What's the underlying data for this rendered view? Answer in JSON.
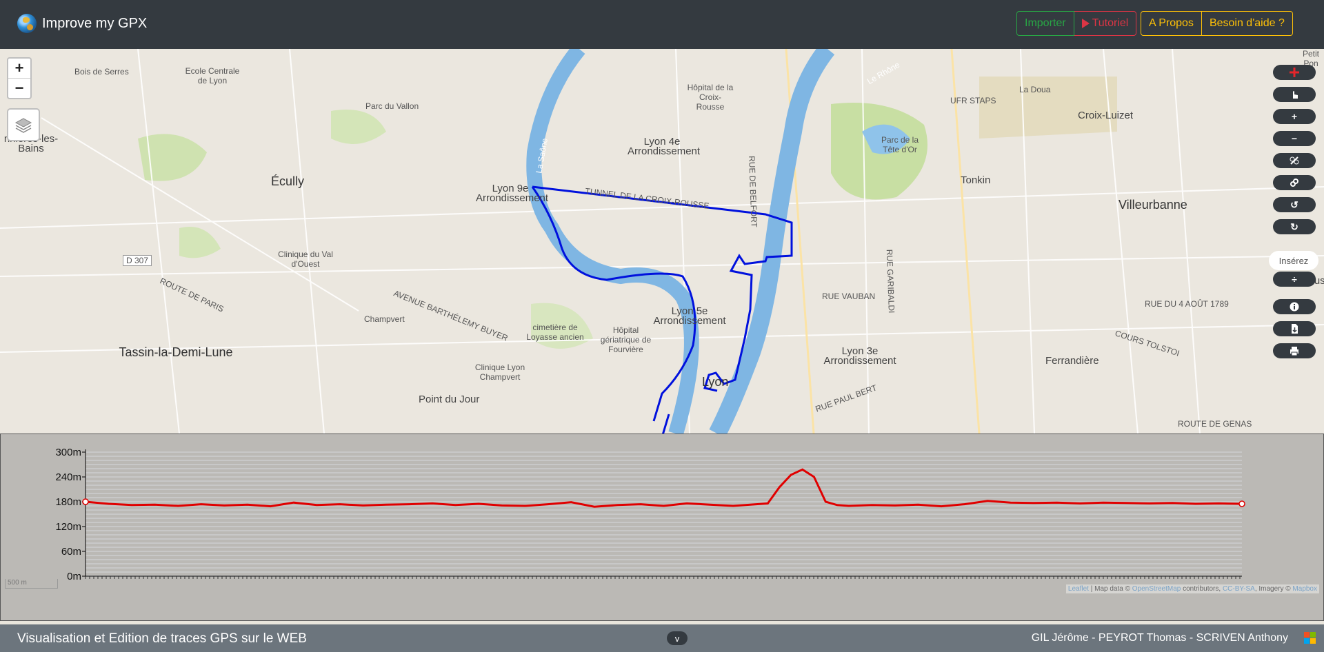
{
  "header": {
    "title": "Improve my GPX",
    "buttons": {
      "import": "Importer",
      "tutorial": "Tutoriel",
      "about": "A Propos",
      "help": "Besoin d'aide ?"
    }
  },
  "map": {
    "labels": [
      {
        "id": "bois",
        "text": "Bois de Serres"
      },
      {
        "id": "ecole",
        "text": "Ecole Centrale de Lyon"
      },
      {
        "id": "parc-vallon",
        "text": "Parc du Vallon"
      },
      {
        "id": "hopital-croix",
        "text": "Hôpital de la Croix-Rousse"
      },
      {
        "id": "lyon4",
        "text": "Lyon 4e Arrondissement"
      },
      {
        "id": "parc-tete",
        "text": "Parc de la Tête d'Or"
      },
      {
        "id": "la-doua",
        "text": "La Doua"
      },
      {
        "id": "ufr",
        "text": "UFR STAPS"
      },
      {
        "id": "croix-luizet",
        "text": "Croix-Luizet"
      },
      {
        "id": "tonkin",
        "text": "Tonkin"
      },
      {
        "id": "villeurbanne",
        "text": "Villeurbanne"
      },
      {
        "id": "ecully",
        "text": "Écully"
      },
      {
        "id": "bonnieres",
        "text": "nnières-les-Bains"
      },
      {
        "id": "lyon9",
        "text": "Lyon 9e Arrondissement"
      },
      {
        "id": "tunnel",
        "text": "TUNNEL DE LA CROIX-ROUSSE"
      },
      {
        "id": "d307",
        "text": "D 307"
      },
      {
        "id": "clinique-val",
        "text": "Clinique du Val d'Ouest"
      },
      {
        "id": "route-paris",
        "text": "ROUTE DE PARIS"
      },
      {
        "id": "champvert",
        "text": "Champvert"
      },
      {
        "id": "avenue-barthelemy",
        "text": "AVENUE BARTHÉLEMY BUYER"
      },
      {
        "id": "cimetiere",
        "text": "cimetière de Loyasse ancien"
      },
      {
        "id": "hopital-fourviere",
        "text": "Hôpital gériatrique de Fourvière"
      },
      {
        "id": "lyon5",
        "text": "Lyon 5e Arrondissement"
      },
      {
        "id": "rue-vauban",
        "text": "RUE VAUBAN"
      },
      {
        "id": "rue-4aout",
        "text": "RUE DU 4 AOÛT 1789"
      },
      {
        "id": "cours-tolstoi",
        "text": "COURS TOLSTOI"
      },
      {
        "id": "tassin",
        "text": "Tassin-la-Demi-Lune"
      },
      {
        "id": "clinique-lyon",
        "text": "Clinique Lyon Champvert"
      },
      {
        "id": "lyon3",
        "text": "Lyon 3e Arrondissement"
      },
      {
        "id": "lyon",
        "text": "Lyon"
      },
      {
        "id": "ferrandiere",
        "text": "Ferrandière"
      },
      {
        "id": "point-jour",
        "text": "Point du Jour"
      },
      {
        "id": "rue-paul-bert",
        "text": "RUE PAUL BERT"
      },
      {
        "id": "route-genas",
        "text": "ROUTE DE GENAS"
      },
      {
        "id": "petit-pont",
        "text": "Petit Pon"
      },
      {
        "id": "la-saone",
        "text": "La Saône"
      },
      {
        "id": "le-rhone",
        "text": "Le Rhône"
      },
      {
        "id": "rue-garibaldi",
        "text": "RUE GARIBALDI"
      },
      {
        "id": "rue-belfort",
        "text": "RUE DE BELFORT"
      },
      {
        "id": "cusset",
        "text": "Cusse"
      }
    ],
    "controls": {
      "zoom_in": "+",
      "zoom_out": "−",
      "insert_label": "Insérez"
    }
  },
  "elevation": {
    "y_ticks": [
      "300m",
      "240m",
      "180m",
      "120m",
      "60m",
      "0m"
    ],
    "scale_label": "500 m",
    "attribution": {
      "leaflet": "Leaflet",
      "sep1": " | Map data © ",
      "osm": "OpenStreetMap",
      "contrib": " contributors, ",
      "license": "CC-BY-SA",
      "imagery": ", Imagery © ",
      "mapbox": "Mapbox"
    }
  },
  "chart_data": {
    "type": "line",
    "title": "",
    "xlabel": "",
    "ylabel": "",
    "ylim": [
      0,
      300
    ],
    "yticks": [
      0,
      60,
      120,
      180,
      240,
      300
    ],
    "series": [
      {
        "color": "#e00000",
        "x": [
          0,
          2,
          4,
          6,
          8,
          10,
          12,
          14,
          16,
          18,
          20,
          22,
          24,
          26,
          28,
          30,
          32,
          34,
          36,
          38,
          40,
          42,
          44,
          46,
          48,
          50,
          52,
          54,
          56,
          58,
          59,
          60,
          61,
          62,
          63,
          64,
          65,
          66,
          68,
          70,
          72,
          74,
          76,
          78,
          80,
          82,
          84,
          86,
          88,
          90,
          92,
          94,
          96,
          98,
          100
        ],
        "values": [
          180,
          175,
          172,
          173,
          170,
          174,
          171,
          173,
          169,
          178,
          172,
          174,
          171,
          173,
          174,
          176,
          172,
          175,
          171,
          170,
          174,
          179,
          168,
          172,
          174,
          170,
          176,
          173,
          170,
          174,
          176,
          215,
          245,
          258,
          240,
          180,
          172,
          170,
          172,
          171,
          173,
          169,
          174,
          182,
          178,
          177,
          178,
          176,
          178,
          177,
          176,
          177,
          175,
          176,
          175
        ]
      }
    ]
  },
  "footer": {
    "left": "Visualisation et Edition de traces GPS sur le WEB",
    "toggle": "v",
    "right": "GIL Jérôme - PEYROT Thomas - SCRIVEN Anthony"
  }
}
